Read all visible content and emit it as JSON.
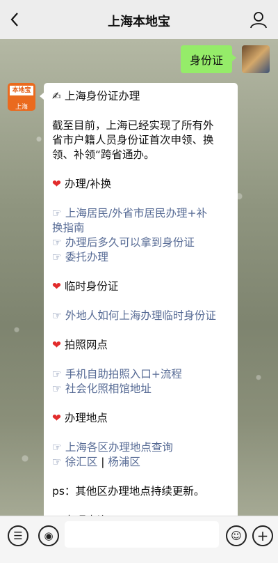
{
  "header": {
    "title": "上海本地宝"
  },
  "chat": {
    "user_message": "身份证",
    "bot_avatar": {
      "brand": "本地宝",
      "city": "上海"
    },
    "bot_lines": [
      {
        "kind": "text",
        "text": "✍ 上海身份证办理"
      },
      {
        "kind": "gap"
      },
      {
        "kind": "text",
        "text": "截至目前，上海已经实现了所有外"
      },
      {
        "kind": "text",
        "text": "省市户籍人员身份证首次申领、换"
      },
      {
        "kind": "text",
        "text": "领、补领“跨省通办。"
      },
      {
        "kind": "gap"
      },
      {
        "kind": "heading",
        "text": "办理/补换"
      },
      {
        "kind": "gap"
      },
      {
        "kind": "link",
        "text": "上海居民/外省市居民办理+补"
      },
      {
        "kind": "link-cont",
        "text": "换指南"
      },
      {
        "kind": "link",
        "text": "办理后多久可以拿到身份证"
      },
      {
        "kind": "link",
        "text": "委托办理"
      },
      {
        "kind": "gap"
      },
      {
        "kind": "heading",
        "text": "临时身份证"
      },
      {
        "kind": "gap"
      },
      {
        "kind": "link",
        "text": "外地人如何上海办理临时身份证"
      },
      {
        "kind": "gap"
      },
      {
        "kind": "heading",
        "text": "拍照网点"
      },
      {
        "kind": "gap"
      },
      {
        "kind": "link",
        "text": "手机自助拍照入口+流程"
      },
      {
        "kind": "link",
        "text": "社会化照相馆地址"
      },
      {
        "kind": "gap"
      },
      {
        "kind": "heading",
        "text": "办理地点"
      },
      {
        "kind": "gap"
      },
      {
        "kind": "link",
        "text": "上海各区办理地点查询"
      },
      {
        "kind": "links",
        "items": [
          "徐汇区",
          "杨浦区"
        ],
        "sep": " | "
      },
      {
        "kind": "gap"
      },
      {
        "kind": "text",
        "text": "ps：其他区办理地点持续更新。"
      },
      {
        "kind": "gap"
      },
      {
        "kind": "heading",
        "text": "办理查询"
      }
    ]
  },
  "icons": {
    "heart": "❤",
    "pointer": "☞",
    "pen": "✍"
  },
  "colors": {
    "bubble_green": "#95ec69",
    "link": "#576b95",
    "heart": "#e22c2c",
    "header_bg": "#ededed"
  }
}
